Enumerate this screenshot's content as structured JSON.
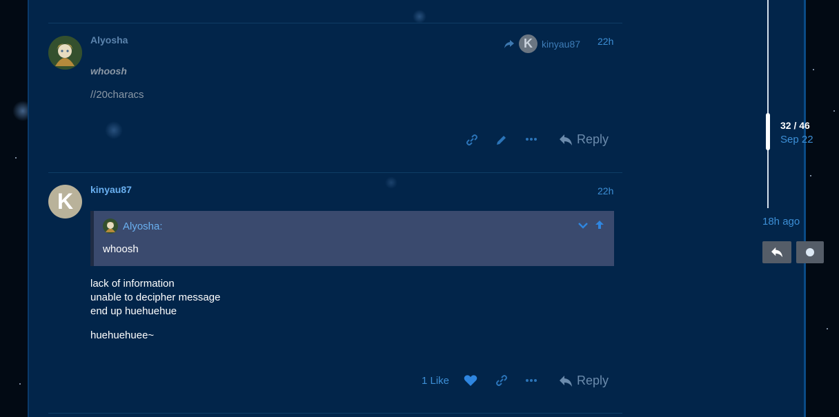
{
  "posts": [
    {
      "username": "Alyosha",
      "time": "22h",
      "reply_to": "kinyau87",
      "lines": [
        "whoosh",
        "//20characs"
      ],
      "reply_label": "Reply"
    },
    {
      "username": "kinyau87",
      "avatar_letter": "K",
      "time": "22h",
      "quote": {
        "author": "Alyosha:",
        "text": "whoosh"
      },
      "lines": [
        "lack of information",
        "unable to decipher message",
        "end up huehuehue",
        "huehuehuee~"
      ],
      "likes_label": "1 Like",
      "reply_label": "Reply"
    }
  ],
  "timeline": {
    "position": "32 / 46",
    "date": "Sep 22",
    "ago": "18h ago"
  },
  "icons": {
    "share": "share-arrow-icon",
    "link": "link-icon",
    "edit": "pencil-icon",
    "more": "ellipsis-icon",
    "like": "heart-icon",
    "reply": "reply-icon",
    "expand": "chevron-down-icon",
    "jump": "arrow-up-icon",
    "dot": "dot-icon"
  },
  "colors": {
    "background": "#020a14",
    "panel": "#02254a",
    "accent": "#3d8fd6",
    "quote_bg": "#3a4a6e"
  }
}
